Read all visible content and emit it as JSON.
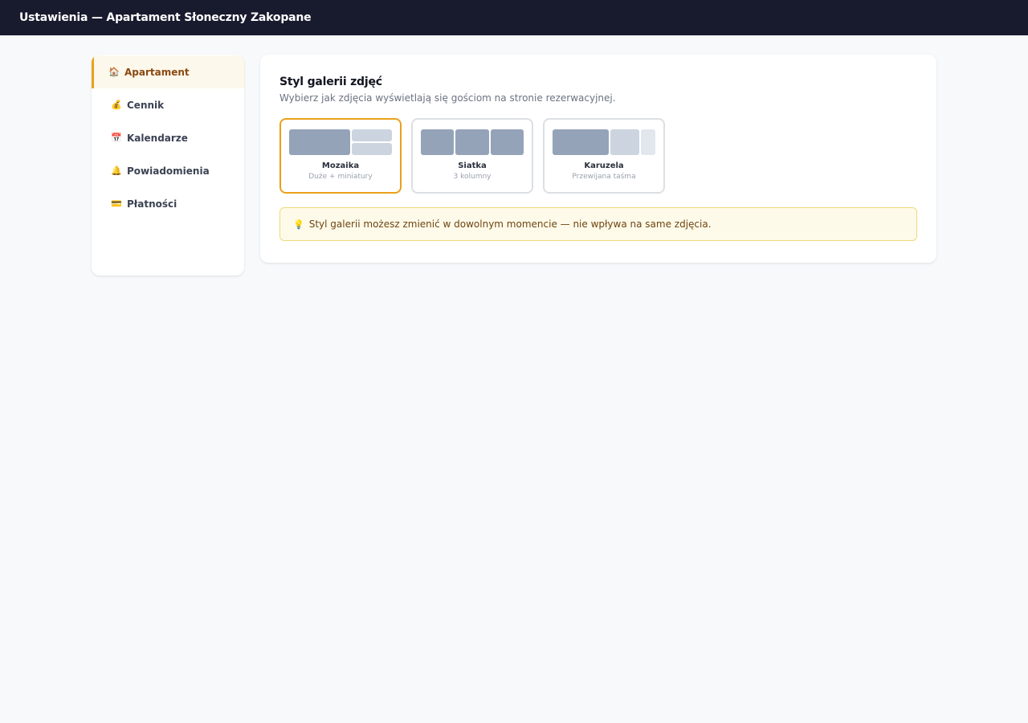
{
  "header": {
    "title": "Ustawienia — Apartament Słoneczny Zakopane"
  },
  "sidebar": {
    "items": [
      {
        "icon": "house-icon",
        "glyph": "🏠",
        "label": "Apartament",
        "active": true
      },
      {
        "icon": "money-bag-icon",
        "glyph": "💰",
        "label": "Cennik",
        "active": false
      },
      {
        "icon": "calendar-icon",
        "glyph": "📅",
        "label": "Kalendarze",
        "active": false
      },
      {
        "icon": "bell-icon",
        "glyph": "🔔",
        "label": "Powiadomienia",
        "active": false
      },
      {
        "icon": "credit-card-icon",
        "glyph": "💳",
        "label": "Płatności",
        "active": false
      }
    ]
  },
  "gallery": {
    "title": "Styl galerii zdjęć",
    "subtitle": "Wybierz jak zdjęcia wyświetlają się gościom na stronie rezerwacyjnej.",
    "options": [
      {
        "label": "Mozaika",
        "sub": "Duże + miniatury",
        "selected": true
      },
      {
        "label": "Siatka",
        "sub": "3 kolumny",
        "selected": false
      },
      {
        "label": "Karuzela",
        "sub": "Przewijana taśma",
        "selected": false
      }
    ],
    "hint": {
      "glyph": "💡",
      "text": "Styl galerii możesz zmienić w dowolnym momencie — nie wpływa na same zdjęcia."
    }
  },
  "colors": {
    "accent": "#e9a11a",
    "topbar": "#181a2e",
    "hint_bg": "#fefae9"
  }
}
